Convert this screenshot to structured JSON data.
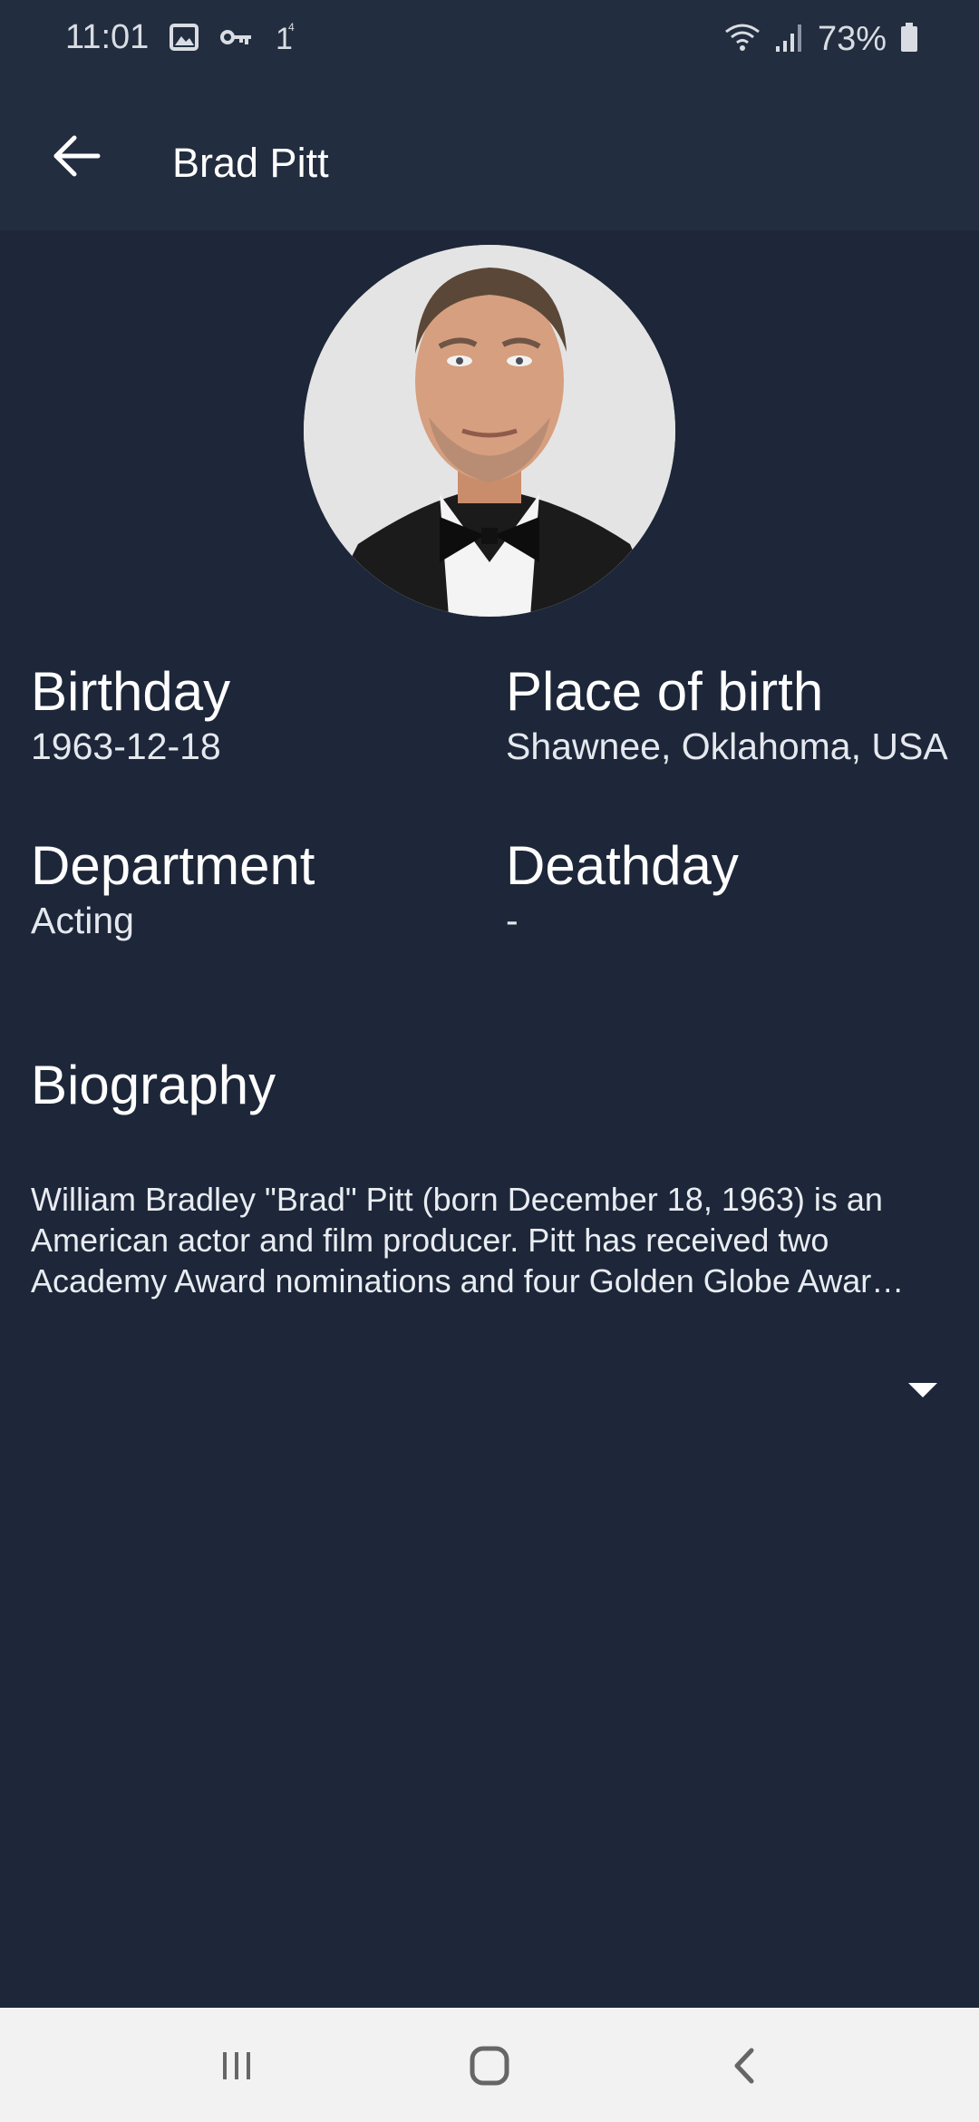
{
  "status_bar": {
    "time": "11:01",
    "battery": "73%",
    "icons_left": [
      "gallery-icon",
      "vpn-key-icon",
      "data-icon"
    ],
    "icons_right": [
      "wifi-icon",
      "signal-icon",
      "battery-icon"
    ]
  },
  "app_bar": {
    "title": "Brad Pitt",
    "back_icon": "arrow-left-icon"
  },
  "profile": {
    "birthday_label": "Birthday",
    "birthday_value": "1963-12-18",
    "place_label": "Place of birth",
    "place_value": "Shawnee, Oklahoma, USA",
    "department_label": "Department",
    "department_value": "Acting",
    "deathday_label": "Deathday",
    "deathday_value": "-"
  },
  "biography": {
    "title": "Biography",
    "text": "William Bradley \"Brad\" Pitt (born December 18, 1963) is an\nAmerican actor and film producer. Pitt has received two\nAcademy Award nominations and four Golden Globe Awar…",
    "expand_icon": "triangle-down-icon"
  },
  "colors": {
    "background": "#1d2739",
    "app_bar": "#222d3f",
    "nav_bar": "#f2f2f2"
  },
  "nav_bar": {
    "items": [
      "recent-apps-icon",
      "home-icon",
      "back-icon"
    ]
  }
}
